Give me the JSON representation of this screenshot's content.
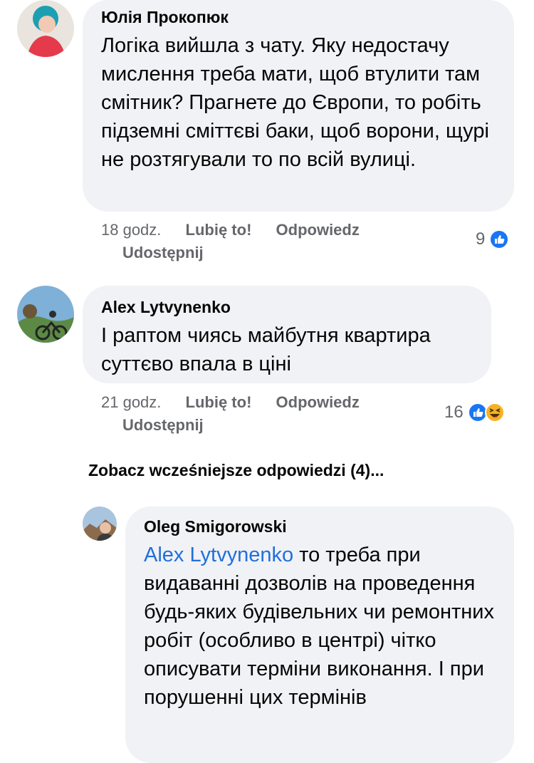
{
  "comments": [
    {
      "author": "Юлія Прокопюк",
      "text": "Логіка вийшла з чату. Яку недостачу мислення треба мати, щоб втулити там смітник? Прагнете до Європи, то робіть підземні сміттєві баки, щоб ворони, щурі не розтягували то по всій вулиці.",
      "time": "18 godz.",
      "like_label": "Lubię to!",
      "reply_label": "Odpowiedz",
      "share_label": "Udostępnij",
      "reaction_count": "9",
      "reactions": [
        "like"
      ]
    },
    {
      "author": "Alex Lytvynenko",
      "text": "І раптом чиясь майбутня квартира суттєво впала в ціні",
      "time": "21 godz.",
      "like_label": "Lubię to!",
      "reply_label": "Odpowiedz",
      "share_label": "Udostępnij",
      "reaction_count": "16",
      "reactions": [
        "like",
        "haha"
      ]
    }
  ],
  "view_more_replies": "Zobacz wcześniejsze odpowiedzi (4)...",
  "reply": {
    "author": "Oleg Smigorowski",
    "mention": "Alex Lytvynenko",
    "text": " то треба при видаванні дозволів на проведення будь-яких будівельних чи ремонтних робіт (особливо в центрі) чітко описувати терміни виконання. І при порушенні цих термінів"
  },
  "colors": {
    "bubble": "#f0f2f5",
    "meta": "#65676b",
    "mention": "#216fdb",
    "like_blue": "#1877f2",
    "haha_yellow": "#f7b125"
  },
  "icons": {
    "like": "like-reaction-icon",
    "haha": "haha-reaction-icon"
  }
}
